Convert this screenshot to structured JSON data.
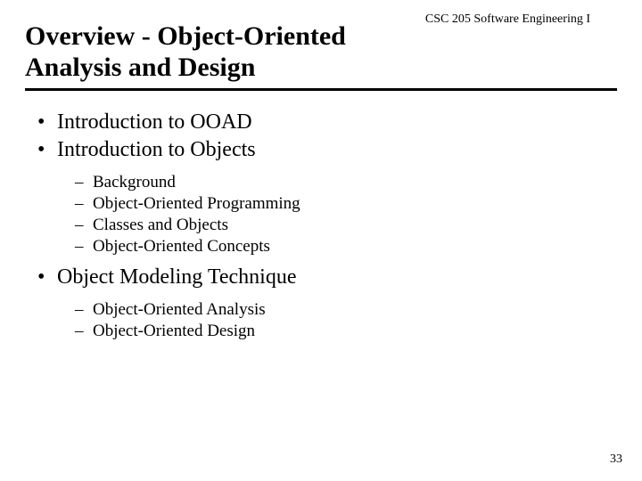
{
  "header": {
    "course": "CSC 205 Software Engineering I"
  },
  "title": "Overview - Object-Oriented Analysis and Design",
  "bullets": {
    "b1": "Introduction to OOAD",
    "b2": "Introduction to Objects",
    "b2_sub": {
      "s1": "Background",
      "s2": "Object-Oriented Programming",
      "s3": "Classes and Objects",
      "s4": "Object-Oriented Concepts"
    },
    "b3": "Object Modeling Technique",
    "b3_sub": {
      "s1": "Object-Oriented Analysis",
      "s2": "Object-Oriented Design"
    }
  },
  "page_number": "33"
}
